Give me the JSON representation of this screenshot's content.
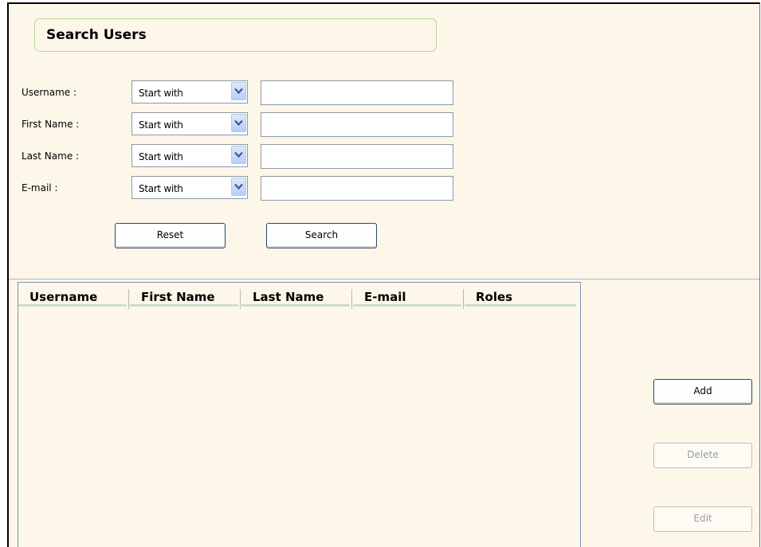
{
  "header": {
    "title": "Search Users"
  },
  "search_form": {
    "fields": [
      {
        "label": "Username :",
        "operator": "Start with",
        "value": ""
      },
      {
        "label": "First Name :",
        "operator": "Start with",
        "value": ""
      },
      {
        "label": "Last Name :",
        "operator": "Start with",
        "value": ""
      },
      {
        "label": "E-mail :",
        "operator": "Start with",
        "value": ""
      }
    ],
    "reset_label": "Reset",
    "search_label": "Search"
  },
  "results_table": {
    "columns": [
      "Username",
      "First Name",
      "Last Name",
      "E-mail",
      "Roles"
    ],
    "rows": []
  },
  "actions": {
    "add_label": "Add",
    "delete_label": "Delete",
    "edit_label": "Edit"
  },
  "icons": {
    "dropdown": "chevron-down-icon"
  },
  "colors": {
    "background": "#fcf7e8",
    "title_border": "#b8d6a0",
    "dropdown_button": "#b7cdf2",
    "header_underline": "#cfe0c3"
  }
}
